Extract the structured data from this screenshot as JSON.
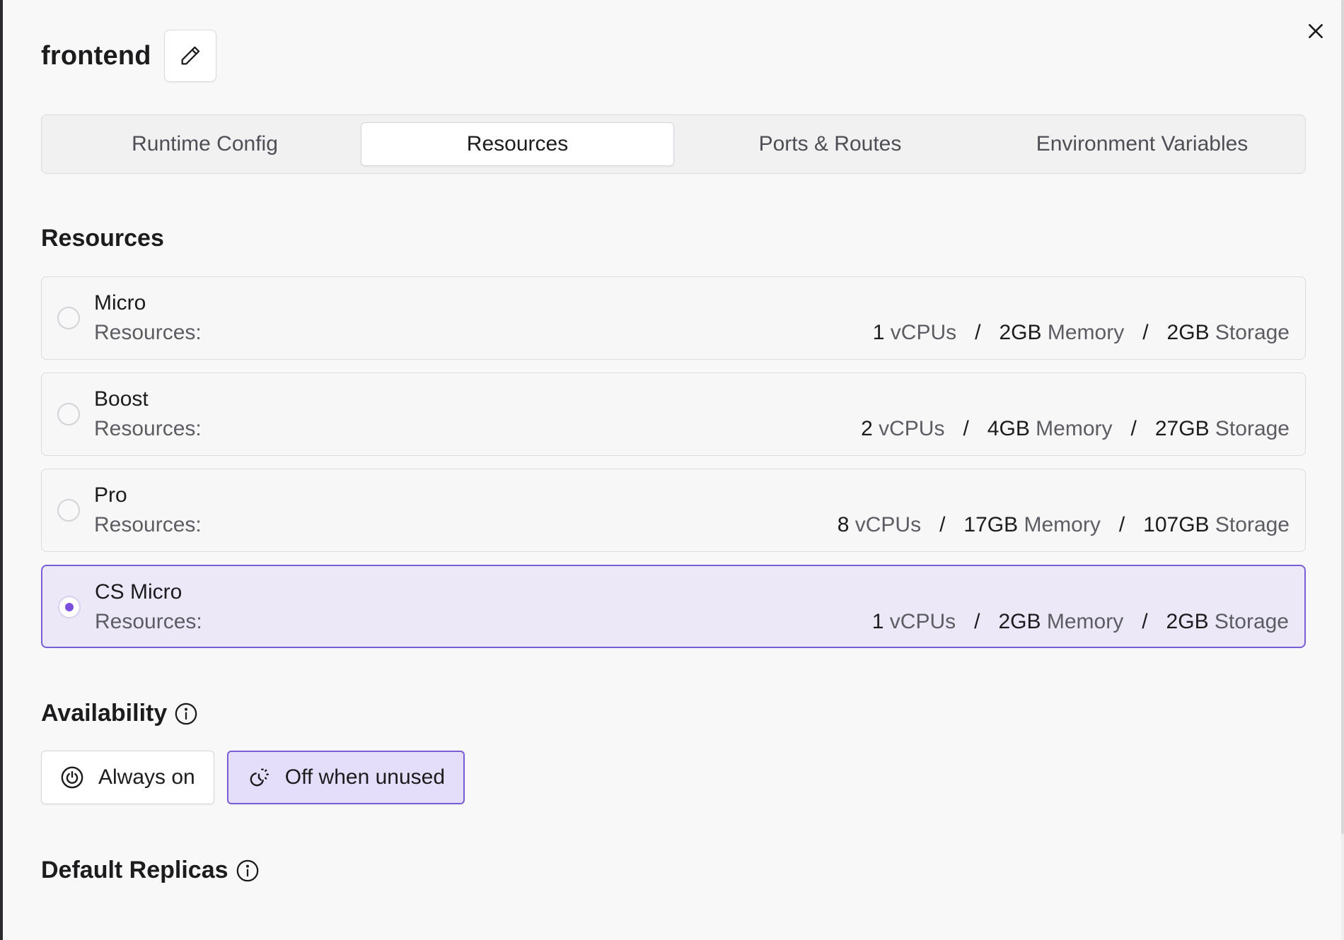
{
  "header": {
    "title": "frontend"
  },
  "tabs": [
    {
      "label": "Runtime Config",
      "active": false
    },
    {
      "label": "Resources",
      "active": true
    },
    {
      "label": "Ports & Routes",
      "active": false
    },
    {
      "label": "Environment Variables",
      "active": false
    }
  ],
  "resources": {
    "title": "Resources",
    "options": [
      {
        "name": "Micro",
        "label": "Resources:",
        "cpu": "1",
        "cpu_unit": "vCPUs",
        "memory": "2GB",
        "memory_unit": "Memory",
        "storage": "2GB",
        "storage_unit": "Storage",
        "selected": false
      },
      {
        "name": "Boost",
        "label": "Resources:",
        "cpu": "2",
        "cpu_unit": "vCPUs",
        "memory": "4GB",
        "memory_unit": "Memory",
        "storage": "27GB",
        "storage_unit": "Storage",
        "selected": false
      },
      {
        "name": "Pro",
        "label": "Resources:",
        "cpu": "8",
        "cpu_unit": "vCPUs",
        "memory": "17GB",
        "memory_unit": "Memory",
        "storage": "107GB",
        "storage_unit": "Storage",
        "selected": false
      },
      {
        "name": "CS Micro",
        "label": "Resources:",
        "cpu": "1",
        "cpu_unit": "vCPUs",
        "memory": "2GB",
        "memory_unit": "Memory",
        "storage": "2GB",
        "storage_unit": "Storage",
        "selected": true
      }
    ],
    "separator": "/"
  },
  "availability": {
    "title": "Availability",
    "always_on": "Always on",
    "off_when_unused": "Off when unused",
    "selected": "off_when_unused"
  },
  "replicas": {
    "title": "Default Replicas"
  },
  "colors": {
    "accent": "#7a5ed6",
    "selected_bg": "#ece8f8",
    "radio_dot": "#7a4fe0"
  },
  "icons": {
    "edit": "pencil-icon",
    "close": "close-icon",
    "info": "info-icon",
    "always_on": "power-icon",
    "off_when_unused": "sleep-icon"
  }
}
